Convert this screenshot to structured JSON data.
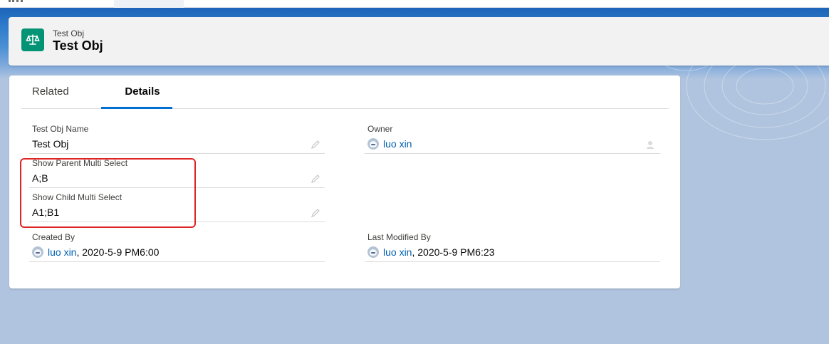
{
  "header": {
    "object_type": "Test Obj",
    "record_title": "Test Obj",
    "icon": "scales-icon"
  },
  "tabs": [
    {
      "label": "Related",
      "selected": false
    },
    {
      "label": "Details",
      "selected": true
    }
  ],
  "fields": {
    "test_obj_name": {
      "label": "Test Obj Name",
      "value": "Test Obj"
    },
    "owner": {
      "label": "Owner",
      "value": "luo xin"
    },
    "show_parent_multi_select": {
      "label": "Show Parent Multi Select",
      "value": "A;B"
    },
    "show_child_multi_select": {
      "label": "Show Child Multi Select",
      "value": "A1;B1"
    },
    "created_by": {
      "label": "Created By",
      "user": "luo xin",
      "date": ", 2020-5-9 PM6:00"
    },
    "last_modified_by": {
      "label": "Last Modified By",
      "user": "luo xin",
      "date": ", 2020-5-9 PM6:23"
    }
  },
  "colors": {
    "brand_blue": "#1c64b7",
    "link": "#005fb2",
    "object_icon": "#039375",
    "annotation": "#e02424"
  }
}
